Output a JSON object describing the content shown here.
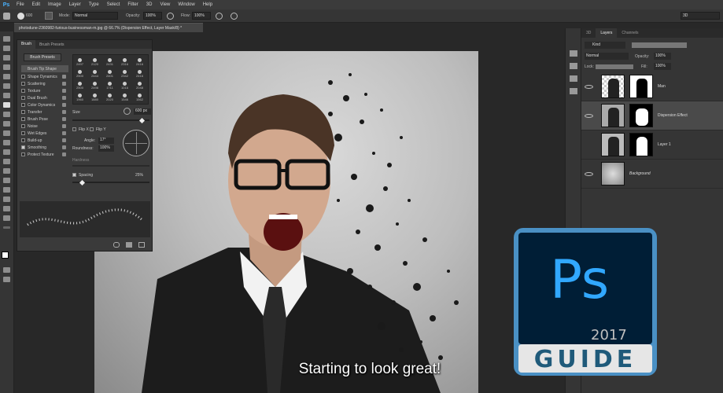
{
  "app": {
    "logo": "Ps"
  },
  "menu": [
    "File",
    "Edit",
    "Image",
    "Layer",
    "Type",
    "Select",
    "Filter",
    "3D",
    "View",
    "Window",
    "Help"
  ],
  "options_bar": {
    "size_value": "600",
    "mode_label": "Mode:",
    "mode_value": "Normal",
    "opacity_label": "Opacity:",
    "opacity_value": "100%",
    "flow_label": "Flow:",
    "flow_value": "100%",
    "workspace_value": "3D"
  },
  "document_tab": "photodune-2360982-furious-businessman-m.jpg @ 66.7% (Dispersion Effect, Layer Mask/8) *",
  "brush_panel": {
    "tabs": [
      "Brush",
      "Brush Presets"
    ],
    "preset_button": "Brush Presets",
    "options": [
      {
        "label": "Brush Tip Shape",
        "checked": false,
        "selected": true
      },
      {
        "label": "Shape Dynamics",
        "checked": false
      },
      {
        "label": "Scattering",
        "checked": false
      },
      {
        "label": "Texture",
        "checked": false
      },
      {
        "label": "Dual Brush",
        "checked": false
      },
      {
        "label": "Color Dynamics",
        "checked": false
      },
      {
        "label": "Transfer",
        "checked": false
      },
      {
        "label": "Brush Pose",
        "checked": false
      },
      {
        "label": "Noise",
        "checked": false
      },
      {
        "label": "Wet Edges",
        "checked": false
      },
      {
        "label": "Build-up",
        "checked": false
      },
      {
        "label": "Smoothing",
        "checked": true
      },
      {
        "label": "Protect Texture",
        "checked": false
      }
    ],
    "tip_sizes": [
      "2497",
      "2120",
      "2431",
      "2316",
      "2416",
      "2500",
      "2444",
      "2401",
      "2342",
      "2416",
      "2500",
      "2498",
      "1711",
      "1016",
      "2048",
      "1960",
      "1880",
      "2020",
      "1546",
      "1562"
    ],
    "size_label": "Size",
    "size_value": "600 px",
    "flip_x": "Flip X",
    "flip_y": "Flip Y",
    "angle_label": "Angle:",
    "angle_value": "17°",
    "roundness_label": "Roundness:",
    "roundness_value": "100%",
    "hardness_label": "Hardness",
    "spacing_label": "Spacing",
    "spacing_value": "25%"
  },
  "layers_panel": {
    "tabs": [
      "3D",
      "Layers",
      "Channels"
    ],
    "kind_label": "Kind",
    "blend_mode": "Normal",
    "opacity_label": "Opacity:",
    "opacity_value": "100%",
    "lock_label": "Lock:",
    "fill_label": "Fill:",
    "fill_value": "100%",
    "layers": [
      {
        "name": "Man",
        "selected": false
      },
      {
        "name": "Dispersion Effect",
        "selected": true
      },
      {
        "name": "Layer 1",
        "selected": false
      },
      {
        "name": "Background",
        "selected": false
      }
    ]
  },
  "subtitle": "Starting to look great!",
  "badge": {
    "logo": "Ps",
    "year": "2017",
    "label": "GUIDE"
  },
  "colors": {
    "ps_blue": "#31a8ff",
    "ps_dark": "#001e36",
    "badge_frame": "#4a90c4"
  }
}
